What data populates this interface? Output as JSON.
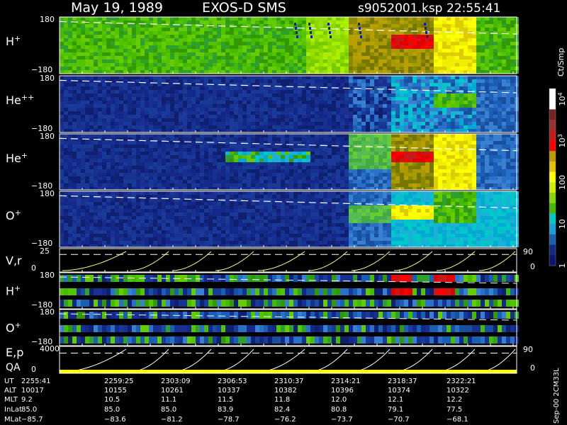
{
  "header": {
    "date": "May 19, 1989",
    "instrument": "EXOS-D SMS",
    "file": "s9052001.ksp",
    "time": "22:55:41"
  },
  "panels": [
    {
      "label": "H",
      "sup": "+",
      "ytop": "180",
      "ybot": "−180",
      "kind": "spec"
    },
    {
      "label": "He",
      "sup": "++",
      "ytop": "180",
      "ybot": "−180",
      "kind": "spec"
    },
    {
      "label": "He",
      "sup": "+",
      "ytop": "180",
      "ybot": "−180",
      "kind": "spec"
    },
    {
      "label": "O",
      "sup": "+",
      "ytop": "180",
      "ybot": "−180",
      "kind": "spec"
    },
    {
      "label": "V,r",
      "sup": "",
      "ytop": "25",
      "ybot": "0",
      "right_top": "90",
      "right_bot": "0",
      "kind": "line"
    },
    {
      "label": "H",
      "sup": "+",
      "ytop": "180",
      "ybot": "−180",
      "kind": "strip"
    },
    {
      "label": "O",
      "sup": "+",
      "ytop": "180",
      "ybot": "−180",
      "kind": "strip"
    },
    {
      "label": "E,p",
      "label2": "QA",
      "sup": "",
      "ytop": "4000",
      "ybot": "0",
      "right_top": "90",
      "right_bot": "0",
      "kind": "line"
    }
  ],
  "colorbar": {
    "title": "Ct/Smp",
    "ticks": [
      {
        "label": "10",
        "sup": "4",
        "value": 10000
      },
      {
        "label": "10",
        "sup": "3",
        "value": 1000
      },
      {
        "label": "100",
        "sup": "",
        "value": 100
      },
      {
        "label": "10",
        "sup": "",
        "value": 10
      },
      {
        "label": "1",
        "sup": "",
        "value": 1
      }
    ],
    "colors": [
      "#ffffff",
      "#ffffff",
      "#7a2222",
      "#9a3030",
      "#c81818",
      "#ff0000",
      "#bd9a00",
      "#e6c000",
      "#ffff00",
      "#d0ee00",
      "#88d800",
      "#44bb00",
      "#00c8c8",
      "#1aa0d8",
      "#1a5fb4",
      "#14288a",
      "#0c1470"
    ]
  },
  "version": "Sep-00 2CM33L",
  "chart_data": {
    "type": "heatmap",
    "rows": [
      "UT",
      "ALT",
      "MLT",
      "InLat",
      "MLat"
    ],
    "ut": [
      "2255:41",
      "2259:25",
      "2303:09",
      "2306:53",
      "2310:37",
      "2314:21",
      "2318:37",
      "2322:21"
    ],
    "alt": [
      10017,
      10155,
      10261,
      10337,
      10382,
      10396,
      10374,
      10322
    ],
    "mlt": [
      9.2,
      10.5,
      11.1,
      11.5,
      11.8,
      12.0,
      12.1,
      12.2
    ],
    "inlat": [
      85.0,
      85.0,
      85.0,
      83.9,
      82.4,
      80.8,
      79.1,
      77.5
    ],
    "mlat": [
      -85.7,
      -83.6,
      -81.2,
      -78.7,
      -76.2,
      -73.7,
      -70.7,
      -68.1
    ],
    "ylim_angle": [
      -180,
      180
    ],
    "ylim_v": [
      0,
      25
    ],
    "ylim_e": [
      0,
      4000
    ],
    "colorbar_range": [
      1,
      10000
    ]
  }
}
